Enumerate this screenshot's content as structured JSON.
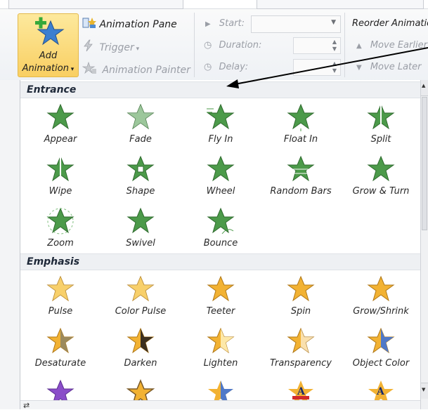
{
  "ribbon": {
    "add_animation": {
      "line1": "Add",
      "line2": "Animation"
    },
    "animation_pane": "Animation Pane",
    "trigger": "Trigger",
    "animation_painter": "Animation Painter",
    "start_label": "Start:",
    "duration_label": "Duration:",
    "delay_label": "Delay:",
    "reorder_label": "Reorder Animatio",
    "move_earlier": "Move Earlier",
    "move_later": "Move Later"
  },
  "gallery": {
    "entrance": {
      "title": "Entrance",
      "items": [
        {
          "label": "Appear",
          "icon": "appear-icon"
        },
        {
          "label": "Fade",
          "icon": "fade-icon"
        },
        {
          "label": "Fly In",
          "icon": "fly-in-icon"
        },
        {
          "label": "Float In",
          "icon": "float-in-icon"
        },
        {
          "label": "Split",
          "icon": "split-icon"
        },
        {
          "label": "Wipe",
          "icon": "wipe-icon"
        },
        {
          "label": "Shape",
          "icon": "shape-icon"
        },
        {
          "label": "Wheel",
          "icon": "wheel-icon"
        },
        {
          "label": "Random Bars",
          "icon": "random-bars-icon"
        },
        {
          "label": "Grow & Turn",
          "icon": "grow-turn-icon"
        },
        {
          "label": "Zoom",
          "icon": "zoom-icon"
        },
        {
          "label": "Swivel",
          "icon": "swivel-icon"
        },
        {
          "label": "Bounce",
          "icon": "bounce-icon"
        }
      ]
    },
    "emphasis": {
      "title": "Emphasis",
      "items": [
        {
          "label": "Pulse",
          "icon": "pulse-icon"
        },
        {
          "label": "Color Pulse",
          "icon": "color-pulse-icon"
        },
        {
          "label": "Teeter",
          "icon": "teeter-icon"
        },
        {
          "label": "Spin",
          "icon": "spin-icon"
        },
        {
          "label": "Grow/Shrink",
          "icon": "grow-shrink-icon"
        },
        {
          "label": "Desaturate",
          "icon": "desaturate-icon"
        },
        {
          "label": "Darken",
          "icon": "darken-icon"
        },
        {
          "label": "Lighten",
          "icon": "lighten-icon"
        },
        {
          "label": "Transparency",
          "icon": "transparency-icon"
        },
        {
          "label": "Object Color",
          "icon": "object-color-icon"
        }
      ]
    }
  },
  "colors": {
    "entrance_star": "#4c9a4a",
    "emphasis_star": "#f2b233",
    "add_button": "#fbd978"
  }
}
